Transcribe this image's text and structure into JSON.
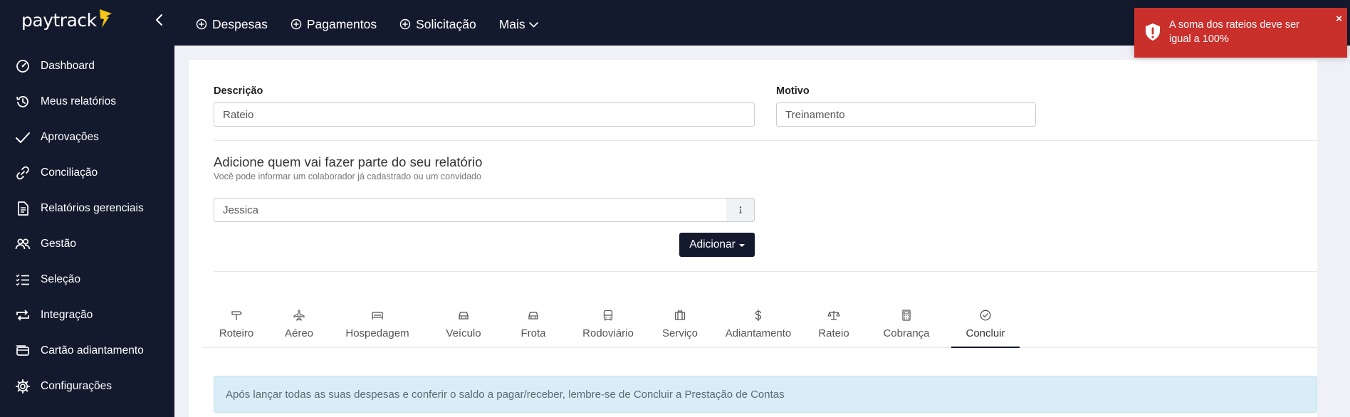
{
  "brand": {
    "logo_text": "paytrack",
    "accent": "#f5c518"
  },
  "sidebar": {
    "items": [
      {
        "label": "Dashboard",
        "icon": "dashboard-gauge-icon"
      },
      {
        "label": "Meus relatórios",
        "icon": "history-icon"
      },
      {
        "label": "Aprovações",
        "icon": "check-icon"
      },
      {
        "label": "Conciliação",
        "icon": "link-icon"
      },
      {
        "label": "Relatórios gerenciais",
        "icon": "document-icon"
      },
      {
        "label": "Gestão",
        "icon": "users-icon"
      },
      {
        "label": "Seleção",
        "icon": "checklist-icon"
      },
      {
        "label": "Integração",
        "icon": "repeat-icon"
      },
      {
        "label": "Cartão adiantamento",
        "icon": "credit-card-icon"
      },
      {
        "label": "Configurações",
        "icon": "gear-icon"
      }
    ]
  },
  "topbar": {
    "despesas": "Despesas",
    "pagamentos": "Pagamentos",
    "solicitacao": "Solicitação",
    "mais": "Mais"
  },
  "form": {
    "descricao_label": "Descrição",
    "descricao_value": "Rateio",
    "motivo_label": "Motivo",
    "motivo_value": "Treinamento"
  },
  "participants": {
    "title": "Adicione quem vai fazer parte do seu relatório",
    "subtitle": "Você pode informar um colaborador já cadastrado ou um convidado",
    "input_value": "Jessica",
    "add_button": "Adicionar"
  },
  "tabs": [
    {
      "label": "Roteiro",
      "icon": "signpost-icon"
    },
    {
      "label": "Aéreo",
      "icon": "plane-icon"
    },
    {
      "label": "Hospedagem",
      "icon": "bed-icon"
    },
    {
      "label": "Veículo",
      "icon": "car-icon"
    },
    {
      "label": "Frota",
      "icon": "fleet-car-icon"
    },
    {
      "label": "Rodoviário",
      "icon": "bus-icon"
    },
    {
      "label": "Serviço",
      "icon": "briefcase-icon"
    },
    {
      "label": "Adiantamento",
      "icon": "dollar-icon"
    },
    {
      "label": "Rateio",
      "icon": "balance-scale-icon"
    },
    {
      "label": "Cobrança",
      "icon": "calculator-icon"
    },
    {
      "label": "Concluir",
      "icon": "check-circle-icon",
      "active": true
    }
  ],
  "info_message": "Após lançar todas as suas despesas e conferir o saldo a pagar/receber, lembre-se de Concluir a Prestação de Contas",
  "toast": {
    "message": "A soma dos rateios deve ser igual a 100%",
    "close": "×",
    "color": "#c9302c"
  }
}
